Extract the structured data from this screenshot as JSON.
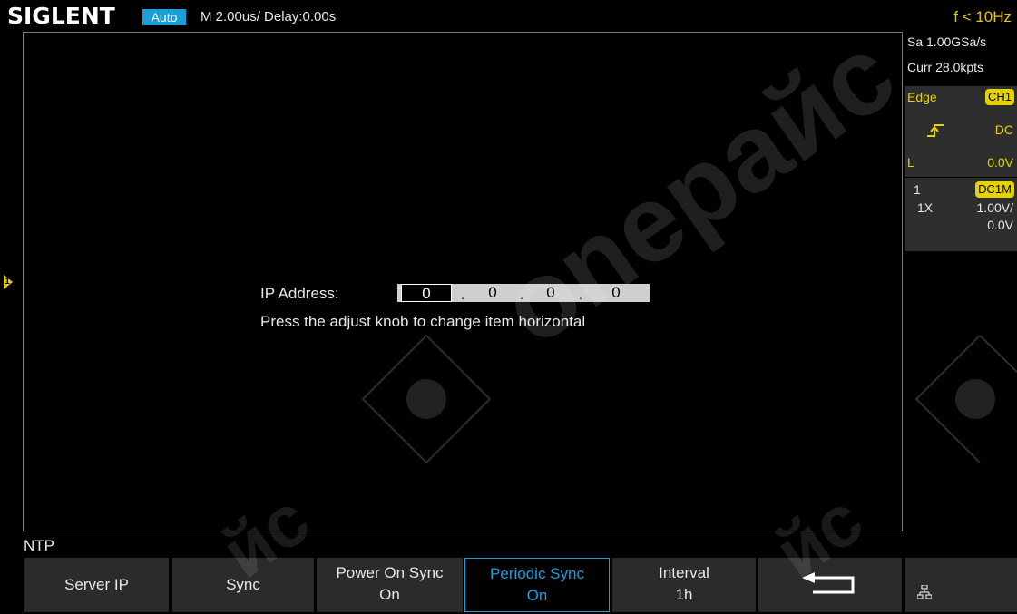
{
  "header": {
    "logo": "SIGLENT",
    "mode": "Auto",
    "timebase": "M 2.00us/  Delay:0.00s",
    "frequency": "f < 10Hz"
  },
  "channel_marker": "1",
  "dialog": {
    "ip_label": "IP Address:",
    "ip_fields": [
      "0",
      "0",
      "0",
      "0"
    ],
    "dot": ".",
    "hint": "Press the adjust knob to change item horizontal"
  },
  "right_panel": {
    "sample_rate": "Sa 1.00GSa/s",
    "memory": "Curr 28.0kpts",
    "trigger_type": "Edge",
    "trigger_source": "CH1",
    "coupling": "DC",
    "level_label": "L",
    "level_value": "0.0V",
    "channel_num": "1",
    "channel_coupling": "DC1M",
    "probe": "1X",
    "volts_div": "1.00V/",
    "offset": "0.0V"
  },
  "menu": {
    "title": "NTP",
    "keys": [
      {
        "l1": "Server IP"
      },
      {
        "l1": "Sync"
      },
      {
        "l1": "Power On Sync",
        "l2": "On"
      },
      {
        "l1": "Periodic Sync",
        "l2": "On"
      },
      {
        "l1": "Interval",
        "l2": "1h"
      }
    ]
  },
  "watermark_text": "оneрайс",
  "icons": {
    "back": "return-arrow-icon",
    "network": "network-icon",
    "trigger_slope": "rising-edge-icon"
  },
  "colors": {
    "accent_blue": "#1a9fd8",
    "channel_yellow": "#e6d200",
    "panel_gray": "#2e2e2e",
    "softkey_gray": "#2b2b2b"
  }
}
